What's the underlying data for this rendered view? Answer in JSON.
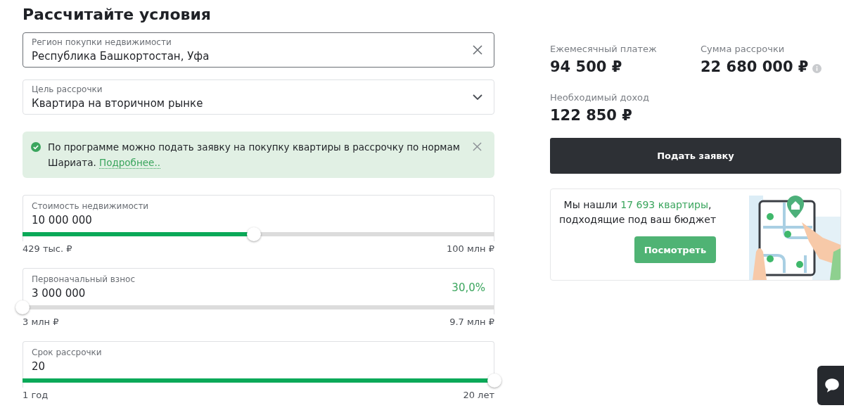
{
  "heading": "Рассчитайте условия",
  "region": {
    "label": "Регион покупки недвижимости",
    "value": "Республика Башкортостан, Уфа"
  },
  "purpose": {
    "label": "Цель рассрочки",
    "value": "Квартира на вторичном рынке"
  },
  "notice": {
    "text": "По программе можно подать заявку на покупку квартиры в рассрочку по нормам Шариата.",
    "link": "Подробнее.."
  },
  "sliders": [
    {
      "label": "Стоимость недвижимости",
      "value": "10 000 000",
      "level": 0.49,
      "min": "429 тыс. ₽",
      "max": "100 млн ₽"
    },
    {
      "label": "Первоначальный взнос",
      "value": "3 000 000",
      "percent": "30,0%",
      "level": 0,
      "min": "3 млн ₽",
      "max": "9.7 млн ₽"
    },
    {
      "label": "Срок рассрочки",
      "value": "20",
      "level": 1,
      "min": "1 год",
      "max": "20 лет"
    }
  ],
  "summary": [
    {
      "label": "Ежемесячный платеж",
      "value": "94 500 ₽",
      "info": false
    },
    {
      "label": "Сумма рассрочки",
      "value": "22 680 000 ₽",
      "info": true
    },
    {
      "label": "Необходимый доход",
      "value": "122 850 ₽",
      "info": false
    }
  ],
  "apply_button": "Подать заявку",
  "promo": {
    "text": "Мы нашли **17 693 квартиры**,\nподходящие под ваш бюджет",
    "button": "Посмотреть"
  }
}
